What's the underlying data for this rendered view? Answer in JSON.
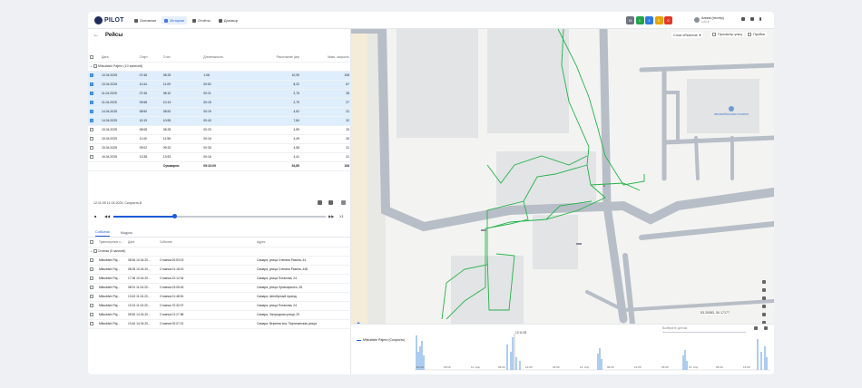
{
  "app": {
    "logo": "PILOT"
  },
  "nav": [
    {
      "label": "Основное",
      "icon": "home-icon",
      "active": false
    },
    {
      "label": "История",
      "icon": "history-icon",
      "active": true
    },
    {
      "label": "Отчёты",
      "icon": "report-icon",
      "active": false
    },
    {
      "label": "Договор",
      "icon": "contract-icon",
      "active": false
    }
  ],
  "badges": [
    {
      "value": "15",
      "color": "#6b7280"
    },
    {
      "value": "1",
      "color": "#22a34a"
    },
    {
      "value": "1",
      "color": "#2d7be0"
    },
    {
      "value": "0",
      "color": "#e5a50a"
    },
    {
      "value": "0",
      "color": "#e0392b"
    }
  ],
  "user": {
    "name": "Алина (тестер)",
    "balance": "0,00 ₽"
  },
  "trips": {
    "title": "Рейсы",
    "columns": [
      "Дата",
      "Старт",
      "Стоп",
      "Длительность",
      "Расстояние (км)",
      "Макс. скорость"
    ],
    "group": "Mitsubishi Pajero (10 записей)",
    "rows": [
      {
        "date": "10.04.2025",
        "start": "07:46",
        "stop": "08:25",
        "duration": "1:08",
        "distance": "10,09",
        "max": "108",
        "selected": true
      },
      {
        "date": "10.04.2025",
        "start": "10:44",
        "stop": "11:09",
        "duration": "00:52",
        "distance": "8,22",
        "max": "67",
        "selected": true
      },
      {
        "date": "11.04.2025",
        "start": "07:46",
        "stop": "08:10",
        "duration": "00:21",
        "distance": "2,76",
        "max": "28",
        "selected": true
      },
      {
        "date": "11.04.2025",
        "start": "09:58",
        "stop": "10:13",
        "duration": "00:15",
        "distance": "2,79",
        "max": "27",
        "selected": true
      },
      {
        "date": "14.04.2025",
        "start": "08:50",
        "stop": "08:52",
        "duration": "00:19",
        "distance": "4,52",
        "max": "31",
        "selected": true
      },
      {
        "date": "14.04.2025",
        "start": "10:19",
        "stop": "10:59",
        "duration": "00:40",
        "distance": "7,84",
        "max": "32",
        "selected": true
      },
      {
        "date": "15.04.2025",
        "start": "08:08",
        "stop": "08:28",
        "duration": "00:20",
        "distance": "4,59",
        "max": "33",
        "selected": false
      },
      {
        "date": "15.04.2025",
        "start": "11:40",
        "stop": "11:56",
        "duration": "00:16",
        "distance": "4,49",
        "max": "30",
        "selected": false
      },
      {
        "date": "15.04.2025",
        "start": "09:02",
        "stop": "09:32",
        "duration": "00:30",
        "distance": "4,58",
        "max": "31",
        "selected": false
      },
      {
        "date": "16.04.2025",
        "start": "13:38",
        "stop": "13:53",
        "duration": "00:16",
        "distance": "4,41",
        "max": "31",
        "selected": false
      }
    ],
    "total": {
      "label": "Суммарно:",
      "duration": "05:33:09",
      "distance": "54,85",
      "max": "108"
    }
  },
  "player": {
    "time": "12:11:05 11.04.2025. Скорость:8",
    "speed": "X1"
  },
  "tabs": [
    {
      "label": "События",
      "active": true
    },
    {
      "label": "Модуль",
      "active": false
    }
  ],
  "events": {
    "columns": [
      "Транспортное с...",
      "Дата",
      "Событие",
      "Адрес"
    ],
    "group": "Стоянки (8 записей)",
    "rows": [
      {
        "vehicle": "Mitsubishi Paj...",
        "date": "08:54 10.04.20...",
        "event": "Стоянка 00:53:19",
        "address": "Самара, улица Степана Разина, 44"
      },
      {
        "vehicle": "Mitsubishi Paj...",
        "date": "08:25 10.04.20...",
        "event": "Стоянка 01:18:19",
        "address": "Самара, улица Степана Разина, 44Б"
      },
      {
        "vehicle": "Mitsubishi Paj...",
        "date": "17:36 10.04.20...",
        "event": "Стоянка 22:12:34",
        "address": "Самара, улица Потапова, 24"
      },
      {
        "vehicle": "Mitsubishi Paj...",
        "date": "08:01 11.04.20...",
        "event": "Стоянка 03:05:43",
        "address": "Самара, улица Луначарского, 28"
      },
      {
        "vehicle": "Mitsubishi Paj...",
        "date": "13:43 11.04.20...",
        "event": "Стоянка 01:48:51",
        "address": "Самара, Автобусный проезд"
      },
      {
        "vehicle": "Mitsubishi Paj...",
        "date": "10:13 11.04.20...",
        "event": "Стоянка 70:32:07",
        "address": "Самара, улица Потапова, 24"
      },
      {
        "vehicle": "Mitsubishi Paj...",
        "date": "08:52 14.04.20...",
        "event": "Стоянка 01:27:58",
        "address": "Самара, Загородная улица, 29"
      },
      {
        "vehicle": "Mitsubishi Paj...",
        "date": "10:44 14.04.20...",
        "event": "Стоянка 00:07:21",
        "address": "Самара, Верхняя ека, Партизанская улица"
      }
    ]
  },
  "map": {
    "layers": "Слои объектов",
    "street_view": "Просмотр улиц",
    "traffic": "Пробки",
    "poi": "автомобильная стоянка",
    "coords": "53.20083, 50.17177"
  },
  "bottom": {
    "sensor_placeholder": "Выберите датчик",
    "legend": "Mitsubishi Pajero (Скорость)",
    "cursor_time": "12:11:05",
    "ticks": [
      "12:00",
      "18:00",
      "11. Апр",
      "06:00",
      "12:00",
      "18:00",
      "12. Апр",
      "06:00",
      "12:00",
      "18:00",
      "13. Апр",
      "06:00",
      "12:00"
    ]
  }
}
